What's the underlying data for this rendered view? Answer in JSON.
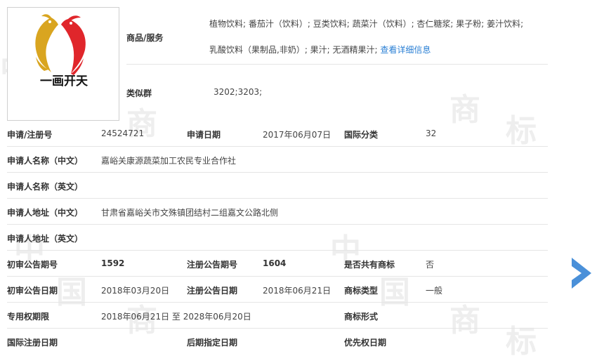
{
  "watermark": {
    "chars": [
      "中",
      "国",
      "商",
      "标"
    ]
  },
  "logo": {
    "text": "一画开天",
    "colors": {
      "gold": "#d9a520",
      "red": "#e0262b",
      "text": "#111111"
    }
  },
  "goods": {
    "label": "商品/服务",
    "line1": "植物饮料; 番茄汁（饮料）; 豆类饮料; 蔬菜汁（饮料）; 杏仁糖浆; 果子粉; 姜汁饮料;",
    "line2": "乳酸饮料（果制品,非奶）; 果汁; 无酒精果汁;",
    "detail_link": "查看详细信息"
  },
  "similar_group": {
    "label": "类似群",
    "value": "3202;3203;"
  },
  "rows": {
    "reg": {
      "reg_no_label": "申请/注册号",
      "reg_no": "24524721",
      "apply_date_label": "申请日期",
      "apply_date": "2017年06月07日",
      "intl_class_label": "国际分类",
      "intl_class": "32"
    },
    "name_cn": {
      "label": "申请人名称（中文）",
      "value": "嘉峪关康源蔬菜加工农民专业合作社"
    },
    "name_en": {
      "label": "申请人名称（英文）",
      "value": ""
    },
    "addr_cn": {
      "label": "申请人地址（中文）",
      "value": "甘肃省嘉峪关市文殊镇团结村二组嘉文公路北侧"
    },
    "addr_en": {
      "label": "申请人地址（英文）",
      "value": ""
    },
    "notice_no": {
      "prelim_label": "初审公告期号",
      "prelim": "1592",
      "reg_label": "注册公告期号",
      "reg": "1604",
      "shared_label": "是否共有商标",
      "shared": "否"
    },
    "notice_date": {
      "prelim_label": "初审公告日期",
      "prelim": "2018年03月20日",
      "reg_label": "注册公告日期",
      "reg": "2018年06月21日",
      "type_label": "商标类型",
      "type": "一般"
    },
    "period": {
      "label": "专用权期限",
      "value": "2018年06月21日 至 2028年06月20日",
      "form_label": "商标形式",
      "form": ""
    },
    "intl": {
      "intl_reg_label": "国际注册日期",
      "intl_reg": "",
      "later_label": "后期指定日期",
      "later": "",
      "priority_label": "优先权日期",
      "priority": ""
    }
  },
  "next_arrow": {
    "icon": "chevron-right-icon",
    "color": "#4a90d9"
  }
}
